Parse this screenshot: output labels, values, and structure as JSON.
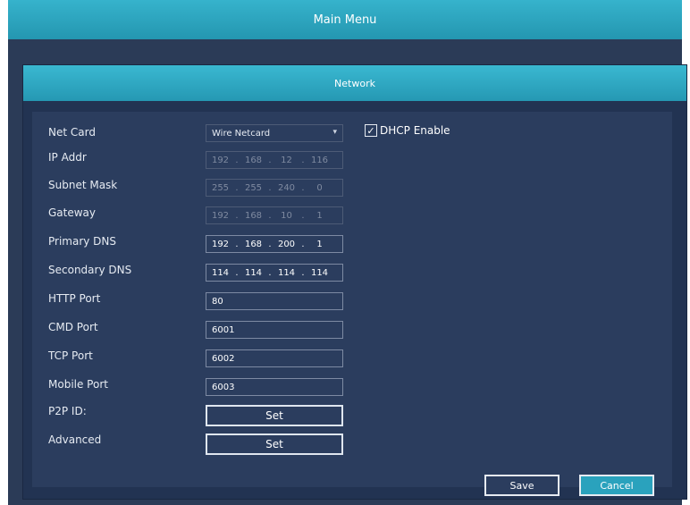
{
  "window": {
    "title": "Main Menu"
  },
  "panel": {
    "title": "Network"
  },
  "fields": {
    "net_card": {
      "label": "Net Card",
      "value": "Wire Netcard"
    },
    "ip_addr": {
      "label": "IP Addr",
      "octets": [
        "192",
        "168",
        "12",
        "116"
      ]
    },
    "subnet_mask": {
      "label": "Subnet Mask",
      "octets": [
        "255",
        "255",
        "240",
        "0"
      ]
    },
    "gateway": {
      "label": "Gateway",
      "octets": [
        "192",
        "168",
        "10",
        "1"
      ]
    },
    "primary_dns": {
      "label": "Primary DNS",
      "octets": [
        "192",
        "168",
        "200",
        "1"
      ]
    },
    "secondary_dns": {
      "label": "Secondary DNS",
      "octets": [
        "114",
        "114",
        "114",
        "114"
      ]
    },
    "http_port": {
      "label": "HTTP Port",
      "value": "80"
    },
    "cmd_port": {
      "label": "CMD Port",
      "value": "6001"
    },
    "tcp_port": {
      "label": "TCP Port",
      "value": "6002"
    },
    "mobile_port": {
      "label": "Mobile Port",
      "value": "6003"
    },
    "p2p_id": {
      "label": "P2P ID:",
      "button": "Set"
    },
    "advanced": {
      "label": "Advanced",
      "button": "Set"
    }
  },
  "dhcp": {
    "label": "DHCP Enable",
    "checked": true,
    "check_mark": "✓"
  },
  "buttons": {
    "save": "Save",
    "cancel": "Cancel"
  },
  "icons": {
    "dropdown": "chevron-down-icon",
    "checkbox": "checkmark-icon"
  },
  "colors": {
    "accent": "#2aa2bd",
    "background": "#2b3d5e"
  }
}
